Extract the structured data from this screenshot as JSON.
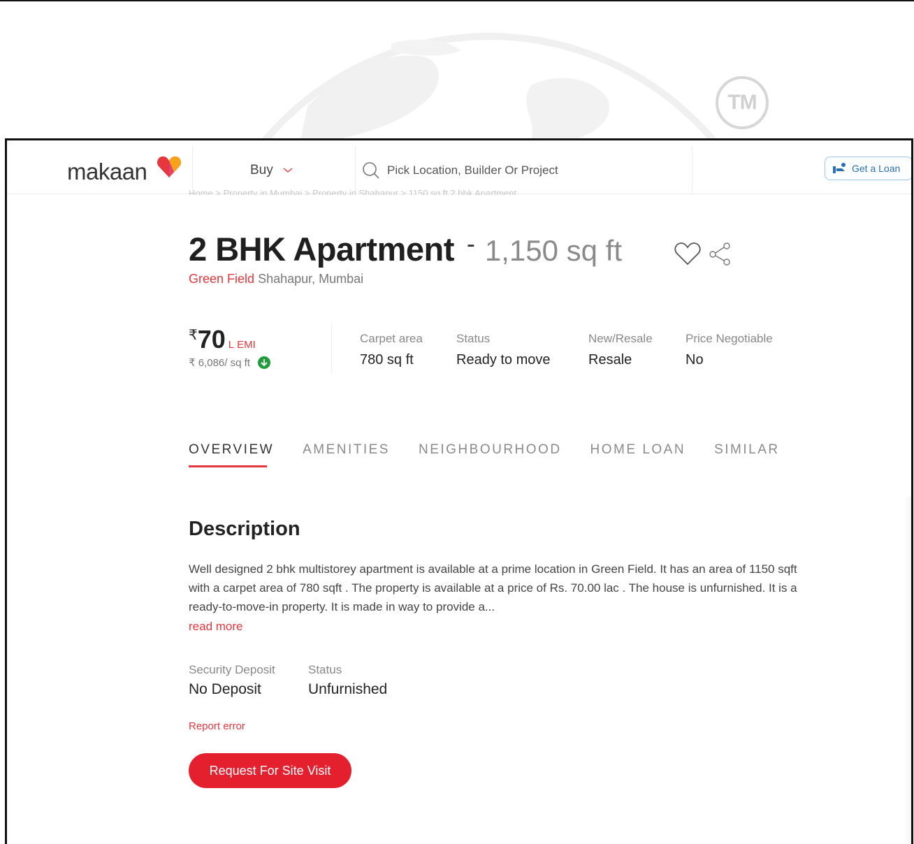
{
  "watermark": {
    "text": "TM"
  },
  "header": {
    "logo": "makaan",
    "buy_label": "Buy",
    "search_placeholder": "Pick Location, Builder Or Project",
    "loan_button": "Get a Loan"
  },
  "breadcrumb": "Home  >  Property in Mumbai  >  Property in Shahapur  >  1150 sq ft 2 bhk Apartment",
  "listing": {
    "title": "2 BHK Apartment",
    "separator": "-",
    "area": "1,150 sq ft",
    "project": "Green Field",
    "locality": "Shahapur,",
    "city": "Mumbai"
  },
  "price": {
    "currency": "₹",
    "amount": "70",
    "unit": "L",
    "emi_label": "EMI",
    "per_sqft": "₹ 6,086/ sq ft"
  },
  "stats": [
    {
      "label": "Carpet area",
      "value": "780 sq ft"
    },
    {
      "label": "Status",
      "value": "Ready to move"
    },
    {
      "label": "New/Resale",
      "value": "Resale"
    },
    {
      "label": "Price Negotiable",
      "value": "No"
    }
  ],
  "tabs": [
    "OVERVIEW",
    "AMENITIES",
    "NEIGHBOURHOOD",
    "HOME LOAN",
    "SIMILAR"
  ],
  "description": {
    "heading": "Description",
    "text": "Well designed 2 bhk multistorey apartment is available at a prime location in Green Field. It has an area of 1150 sqft with a carpet area of 780 sqft . The property is available at a price of Rs. 70.00 lac . The house is unfurnished. It is a ready-to-move-in property. It is made in way to provide a...",
    "read_more": "read more"
  },
  "details": [
    {
      "label": "Security Deposit",
      "value": "No Deposit"
    },
    {
      "label": "Status",
      "value": "Unfurnished"
    }
  ],
  "report_error": "Report error",
  "cta": "Request For Site Visit",
  "colors": {
    "accent": "#e5373d",
    "cta": "#e5202e",
    "loan_blue": "#2a6fb0",
    "badge_green": "#1f9d3a"
  }
}
